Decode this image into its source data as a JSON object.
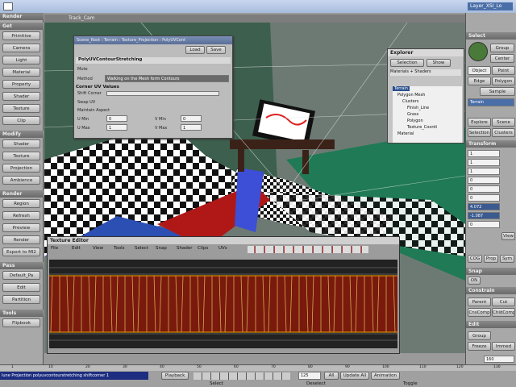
{
  "topbar": {
    "layer": "Layer_XSI_Lo"
  },
  "left": {
    "header": "Render",
    "sections": [
      {
        "title": "Get",
        "items": [
          "Primitive",
          "Camera",
          "Light",
          "Material",
          "Property",
          "Shader",
          "Texture",
          "Clip"
        ]
      },
      {
        "title": "Modify",
        "items": [
          "Shader",
          "Texture",
          "Projection",
          "Ambience"
        ]
      },
      {
        "title": "Render",
        "items": [
          "Region",
          "Refresh",
          "Preview",
          "Render",
          "Export to MI2"
        ]
      },
      {
        "title": "Pass",
        "items": [
          "Default_Pa",
          "Edit",
          "Partition"
        ]
      },
      {
        "title": "Tools",
        "items": [
          "Flipbook"
        ]
      }
    ]
  },
  "viewport": {
    "title": "Track_Cam"
  },
  "ppg": {
    "path": "Scene_Root : Terrain : Texture_Projection : PolyUVCont",
    "load": "Load",
    "save": "Save",
    "section": "PolyUVContourStretching",
    "mute": "Mute",
    "method_label": "Method",
    "method_value": "Walking on the Mesh form Contours",
    "corner_section": "Corner UV Values",
    "shift_label": "Shift Corner",
    "swap_label": "Swap UV",
    "maintain_label": "Maintain Aspect",
    "umin": "U Min",
    "umax": "U Max",
    "vmin": "V Min",
    "vmax": "V Max",
    "umin_val": "0",
    "umax_val": "1",
    "vmin_val": "0",
    "vmax_val": "1"
  },
  "explorer": {
    "title": "Explorer",
    "selection": "Selection",
    "show": "Show",
    "filter": "Materials + Shaders",
    "tree": [
      "Terrain",
      "Polygon Mesh",
      "Clusters",
      "Finish_Line",
      "Grass",
      "Polygon",
      "Texture_Coordi",
      "Material"
    ]
  },
  "right": {
    "select": "Select",
    "group": "Group",
    "center": "Center",
    "object": "Object",
    "point": "Point",
    "edge": "Edge",
    "polygon": "Polygon",
    "sample": "Sample",
    "terrain": "Terrain",
    "explore": "Explore",
    "scene": "Scene",
    "selection": "Selection",
    "clusters": "Clusters",
    "transform": "Transform",
    "vals": [
      "1",
      "1",
      "1",
      "0",
      "0",
      "0",
      "4.072",
      "-1.087",
      "0"
    ],
    "view": "View",
    "cog": "COG",
    "prop": "Prop",
    "sym": "Sym",
    "snap": "Snap",
    "on": "ON",
    "constrain": "Constrain",
    "parent": "Parent",
    "cut": "Cut",
    "cnscomp": "CnsComp",
    "chldcomp": "ChldComp",
    "edit": "Edit",
    "freeze": "Freeze",
    "immed": "Immed",
    "frame": "160"
  },
  "texed": {
    "title": "Texture Editor",
    "menus": [
      "File",
      "Edit",
      "View",
      "Tools",
      "Select",
      "Snap",
      "Shader",
      "Clips",
      "UVs"
    ]
  },
  "timeline": {
    "cmd": "lune Projection polyuvcontourstretching shiftcorner 1",
    "playback": "Playback",
    "frame": "125",
    "all": "All",
    "update": "Update All",
    "animation": "Animation",
    "ticks": [
      "1",
      "",
      "10",
      "",
      "20",
      "",
      "30",
      "",
      "40",
      "",
      "50",
      "",
      "60",
      "",
      "70",
      "",
      "80",
      "",
      "90",
      "",
      "100",
      "",
      "110",
      "",
      "120",
      "",
      "130"
    ],
    "status": [
      "Select",
      "Deselect",
      "Toggle"
    ]
  }
}
